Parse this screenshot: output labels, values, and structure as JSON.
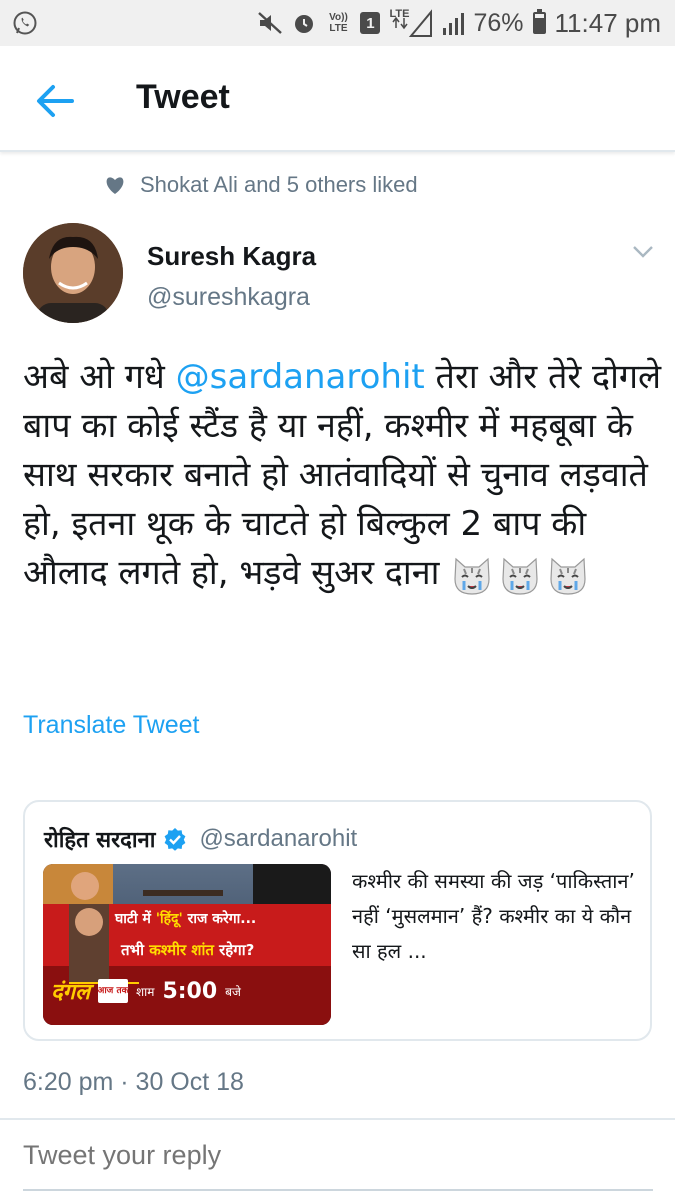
{
  "status_bar": {
    "lte_label": "LTE",
    "volte_label": "Vo)) LTE",
    "sim_badge": "1",
    "battery_percent": "76%",
    "battery_level": 0.76,
    "time": "11:47 pm",
    "icons": [
      "whatsapp-icon",
      "mute-icon",
      "alarm-icon",
      "volte-icon",
      "sim-icon",
      "lte-signal-icon",
      "signal-icon",
      "battery-icon"
    ]
  },
  "app_bar": {
    "title": "Tweet",
    "back_icon": "arrow-left-icon"
  },
  "liked": {
    "text": "Shokat Ali and 5 others liked",
    "icon": "heart-icon"
  },
  "tweet": {
    "author_name": "Suresh Kagra",
    "author_handle": "@sureshkagra",
    "text_part1": "अबे ओ गधे ",
    "mention": "@sardanarohit",
    "text_part2": " तेरा और तेरे दोगले बाप का कोई स्टैंड है या नहीं, कश्मीर में महबूबा के साथ सरकार बनाते हो आतंवादियों से चुनाव लड़वाते हो, इतना थूक के चाटते हो बिल्कुल 2 बाप की औलाद लगते हो, भड़वे सुअर दाना ",
    "emoji_icons": [
      "crying-cat-icon",
      "crying-cat-icon",
      "crying-cat-icon"
    ],
    "translate_label": "Translate Tweet",
    "timestamp": "6:20 pm · 30 Oct 18"
  },
  "quoted_tweet": {
    "name": "रोहित सरदाना",
    "handle": "@sardanarohit",
    "text": "कश्मीर की समस्या की जड़ ‘पाकिस्तान’ नहीं ‘मुसलमान’ हैं? कश्मीर का ये कौन सा हल ...",
    "thumb_line1_a": "घाटी में ",
    "thumb_line1_b": "'हिंदू'",
    "thumb_line1_c": " राज करेगा...",
    "thumb_line2_a": "तभी ",
    "thumb_line2_b": "कश्मीर शांत",
    "thumb_line2_c": " रहेगा?",
    "thumb_show": "दंगल",
    "thumb_channel": "आज तक",
    "thumb_time_prefix": "शाम",
    "thumb_time": "5:00",
    "thumb_time_suffix": "बजे"
  },
  "reply": {
    "placeholder": "Tweet your reply"
  },
  "colors": {
    "accent": "#1da1f2",
    "secondary_text": "#657786",
    "border": "#e1e8ed"
  }
}
